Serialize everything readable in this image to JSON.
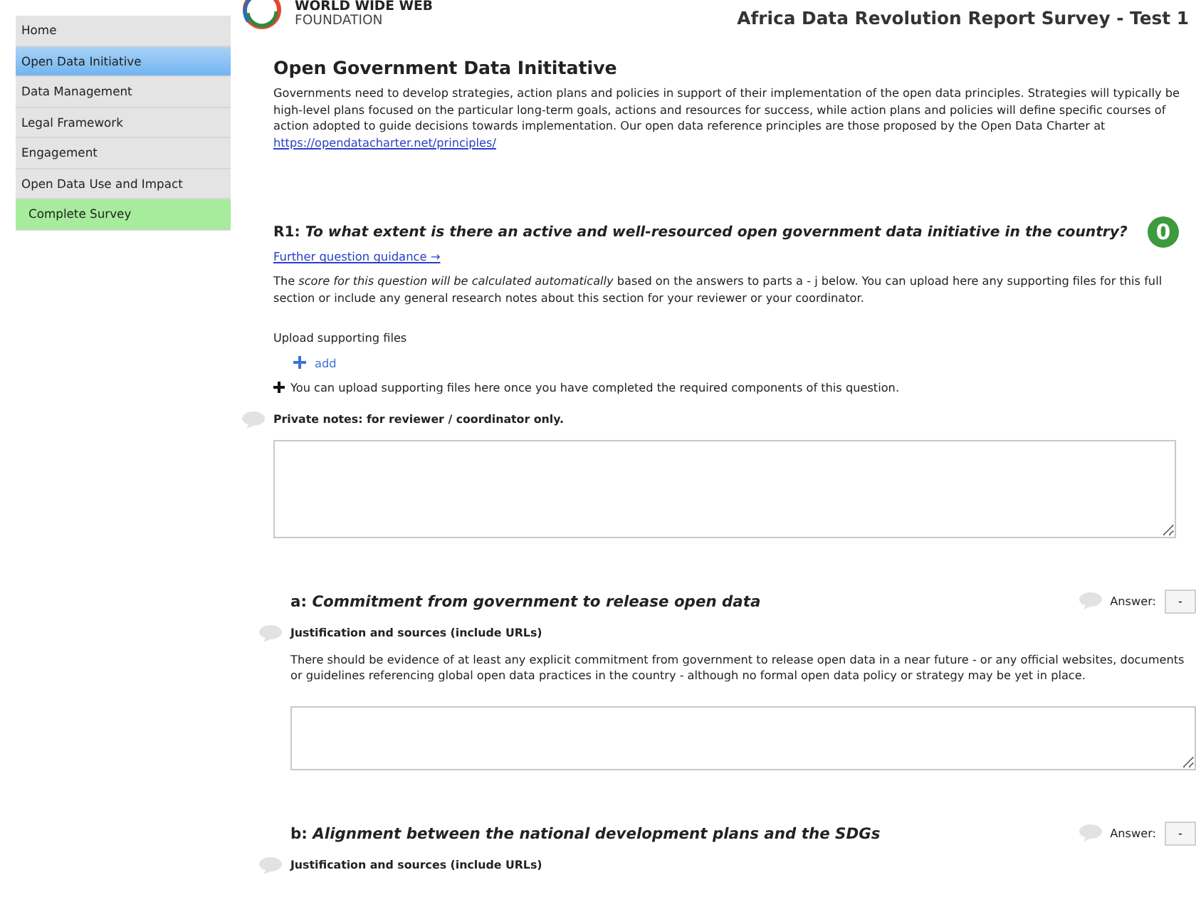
{
  "sidebar": {
    "items": [
      {
        "label": "Home",
        "selected": false,
        "kind": "nav"
      },
      {
        "label": "Open Data Initiative",
        "selected": true,
        "kind": "nav"
      },
      {
        "label": "Data Management",
        "selected": false,
        "kind": "nav"
      },
      {
        "label": "Legal Framework",
        "selected": false,
        "kind": "nav"
      },
      {
        "label": "Engagement",
        "selected": false,
        "kind": "nav"
      },
      {
        "label": "Open Data Use and Impact",
        "selected": false,
        "kind": "nav"
      },
      {
        "label": "Complete Survey",
        "selected": false,
        "kind": "action"
      }
    ]
  },
  "header": {
    "logo_line_1": "WORLD WIDE WEB",
    "logo_line_2": "FOUNDATION",
    "title": "Africa Data Revolution Report Survey - Test 1"
  },
  "section": {
    "title": "Open Government Data Inititative",
    "intro": "Governments need to develop strategies, action plans and policies in support of their implementation of the open data principles. Strategies will typically be high-level plans focused on the particular long-term goals, actions and resources for success, while action plans and policies will define specific courses of action adopted to guide decisions towards implementation. Our open data reference principles are those proposed by the Open Data Charter at",
    "intro_link": "https://opendatacharter.net/principles/"
  },
  "question": {
    "code": "R1:",
    "text": "To what extent is there an active and well-resourced open government data initiative in the country?",
    "score": "0",
    "guidance_link": "Further question guidance →",
    "description": "The *score for this question will be calculated automatically* based on the answers to parts a - j below. You can upload here any supporting files for this full section or include any general research notes about this section for your reviewer or your coordinator.",
    "upload_label": "Upload supporting files",
    "add_button": "add",
    "upload_note": "You can upload supporting files here once you have completed the required components of this question.",
    "notes_label": "Private notes: for reviewer / coordinator only."
  },
  "parts": [
    {
      "code": "a:",
      "title": "Commitment from government to release open data",
      "answer_label": "Answer:",
      "answer": "-",
      "justification_label": "Justification and sources (include URLs)",
      "description": "There should be evidence of at least any explicit commitment from government to release open data in a near future - or any official websites, documents or guidelines referencing global open data practices in the country - although no formal open data policy or strategy may be yet in place.",
      "has_field": true
    },
    {
      "code": "b:",
      "title": "Alignment between the national development plans and the SDGs",
      "answer_label": "Answer:",
      "answer": "-",
      "justification_label": "Justification and sources (include URLs)",
      "has_field": false
    }
  ]
}
